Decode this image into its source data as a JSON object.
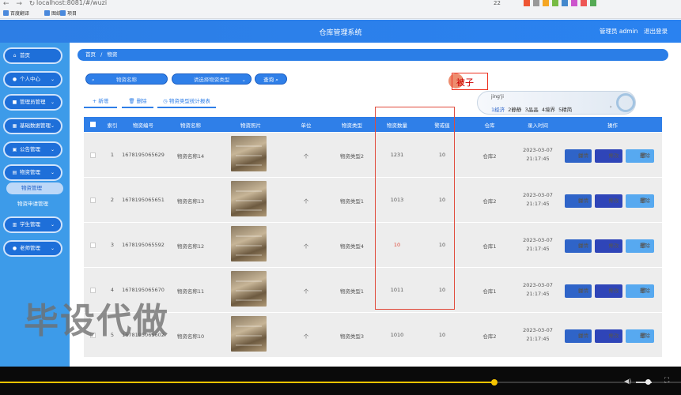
{
  "browser": {
    "url": "localhost:8081/#/wuzi",
    "bookmarks": [
      "百度翻译",
      "图纸",
      "项目"
    ],
    "nav_icons": "← → ↻",
    "zoom": "22"
  },
  "header": {
    "title": "仓库管理系统",
    "admin": "管理员 admin",
    "logout": "退出登录"
  },
  "sidebar": {
    "items": [
      {
        "label": "首页",
        "icon": "home-icon",
        "glyph": "⌂"
      },
      {
        "label": "个人中心",
        "icon": "user-icon",
        "glyph": "●",
        "arrow": "⌄"
      },
      {
        "label": "管理员管理",
        "icon": "lock-icon",
        "glyph": "■",
        "arrow": "⌄"
      },
      {
        "label": "基础数据管理",
        "icon": "grid-icon",
        "glyph": "▦",
        "arrow": "⌄"
      },
      {
        "label": "公告管理",
        "icon": "notice-icon",
        "glyph": "▣",
        "arrow": "⌄"
      },
      {
        "label": "物资管理",
        "icon": "box-icon",
        "glyph": "▤",
        "arrow": "⌄"
      },
      {
        "label": "学生管理",
        "icon": "student-icon",
        "glyph": "▥",
        "arrow": "⌄"
      },
      {
        "label": "老师管理",
        "icon": "teacher-icon",
        "glyph": "●",
        "arrow": "⌄"
      }
    ],
    "sub_items": [
      "物资管理",
      "物资申请管理"
    ]
  },
  "breadcrumb": {
    "home": "首页",
    "sep": "/",
    "current": "物资"
  },
  "search": {
    "name_placeholder": "物资名称",
    "type_placeholder": "请选择物资类型",
    "query_button": "查询",
    "search_glyph": "⌕",
    "select_glyph": "⌄"
  },
  "toolbar": {
    "add": "+ 新增",
    "delete": "🗑 删除",
    "stats": "◷ 物资类型统计报表"
  },
  "ime": {
    "composing": "被子",
    "pinyin": "jing'ji",
    "candidates": [
      "1经济",
      "2静静",
      "3晶晶",
      "4境界",
      "5精简"
    ],
    "more": "›"
  },
  "table": {
    "headers": [
      "索引",
      "物资编号",
      "物资名称",
      "物资照片",
      "单位",
      "物资类型",
      "物资数量",
      "警戒值",
      "仓库",
      "录入时间",
      "操作"
    ],
    "actions": {
      "detail": "详情",
      "edit": "修改",
      "delete": "删除",
      "detail_glyph": "▤",
      "edit_glyph": "✎",
      "delete_glyph": "🗑"
    },
    "rows": [
      {
        "index": "1",
        "code": "1678195065629",
        "name": "物资名称14",
        "unit": "个",
        "type": "物资类型2",
        "qty": "1231",
        "qty_alert": false,
        "alert": "10",
        "warehouse": "仓库2",
        "time": "2023-03-07 21:17:45"
      },
      {
        "index": "2",
        "code": "1678195065651",
        "name": "物资名称13",
        "unit": "个",
        "type": "物资类型1",
        "qty": "1013",
        "qty_alert": false,
        "alert": "10",
        "warehouse": "仓库2",
        "time": "2023-03-07 21:17:45"
      },
      {
        "index": "3",
        "code": "1678195065592",
        "name": "物资名称12",
        "unit": "个",
        "type": "物资类型4",
        "qty": "10",
        "qty_alert": true,
        "alert": "10",
        "warehouse": "仓库1",
        "time": "2023-03-07 21:17:45"
      },
      {
        "index": "4",
        "code": "1678195065670",
        "name": "物资名称11",
        "unit": "个",
        "type": "物资类型1",
        "qty": "1011",
        "qty_alert": false,
        "alert": "10",
        "warehouse": "仓库1",
        "time": "2023-03-07 21:17:45"
      },
      {
        "index": "5",
        "code": "1678195065602",
        "name": "物资名称10",
        "unit": "个",
        "type": "物资类型3",
        "qty": "1010",
        "qty_alert": false,
        "alert": "10",
        "warehouse": "仓库2",
        "time": "2023-03-07 21:17:45"
      }
    ]
  },
  "watermark": "毕设代做",
  "player": {
    "progress": 0.726,
    "volume": 0.75,
    "volume_glyph": "◀)",
    "fullscreen_glyph": "⛶"
  },
  "colors": {
    "primary": "#2f7fe8",
    "sidebar": "#3d9be9",
    "alert_text": "#e04a3b",
    "highlight_box": "#e04a3b"
  }
}
